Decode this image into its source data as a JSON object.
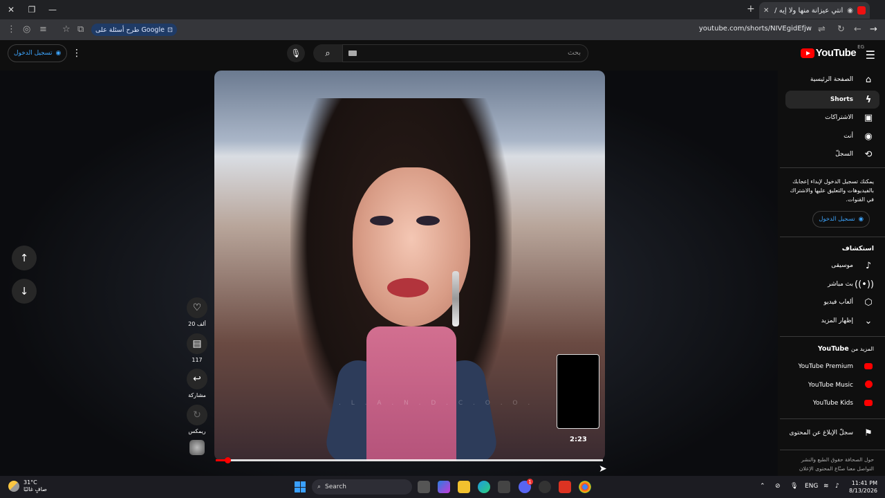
{
  "browser": {
    "tab_title": "أنتي عيزانة منها ولا إيه / شابر",
    "url": "youtube.com/shorts/NIVEgidEfjw",
    "google_chip": "طرح أسئلة على Google"
  },
  "header": {
    "logo_text": "YouTube",
    "country_code": "EG",
    "search_placeholder": "بحث",
    "signin_label": "تسجيل الدخول"
  },
  "video": {
    "watermark": ". L . A . N . D . C . O . O .",
    "mini_duration": "2:23",
    "progress_fraction": 0.03
  },
  "actions": {
    "likes": "20 ألف",
    "comments": "117",
    "share": "مشاركة",
    "remix": "ريمكس"
  },
  "sidebar": {
    "nav": [
      {
        "label": "الصفحة الرئيسية",
        "icon": "home-icon"
      },
      {
        "label": "Shorts",
        "icon": "shorts-icon"
      },
      {
        "label": "الاشتراكات",
        "icon": "subscriptions-icon"
      },
      {
        "label": "أنت",
        "icon": "you-icon"
      },
      {
        "label": "السجلّ",
        "icon": "history-icon"
      }
    ],
    "signin_prompt": "يمكنك تسجيل الدخول لإبداء إعجابك بالفيديوهات والتعليق عليها والاشتراك في القنوات.",
    "signin_label": "تسجيل الدخول",
    "explore_title": "استكشاف",
    "explore": [
      {
        "label": "موسيقى",
        "icon": "music-icon"
      },
      {
        "label": "بث مباشر",
        "icon": "live-icon"
      },
      {
        "label": "ألعاب فيديو",
        "icon": "gaming-icon"
      },
      {
        "label": "إظهار المزيد",
        "icon": "chevron-down-icon"
      }
    ],
    "more_title_prefix": "المزيد من",
    "more_title_brand": "YouTube",
    "more": [
      {
        "label": "YouTube Premium"
      },
      {
        "label": "YouTube Music"
      },
      {
        "label": "YouTube Kids"
      }
    ],
    "report": "سجلّ الإبلاغ عن المحتوى",
    "footer_line1": "حول  الصحافة  حقوق الطبع والنشر",
    "footer_line2": "التواصل معنا  صنّاع المحتوى  الإعلان"
  },
  "taskbar": {
    "temp": "31°C",
    "weather": "صافٍ غالبًا",
    "search": "Search",
    "lang": "ENG",
    "time": "11:41 PM",
    "date": "8/13/2026",
    "discord_badge": "1"
  }
}
